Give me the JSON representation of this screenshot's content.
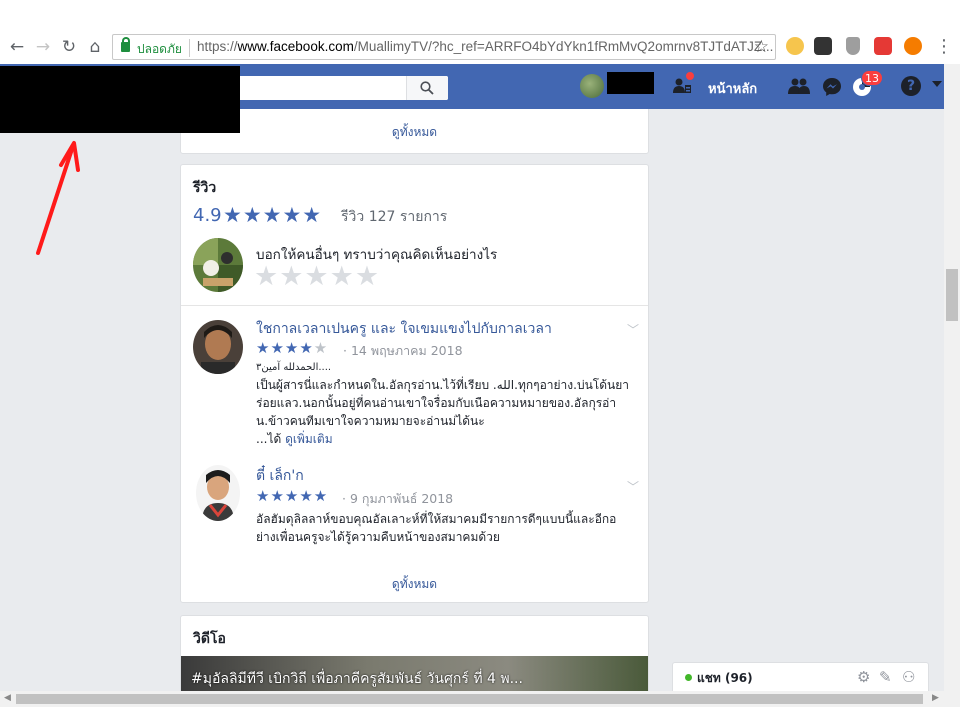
{
  "browser": {
    "secure_label": "ปลอดภัย",
    "url_prefix": "https://",
    "url_host": "www.facebook.com",
    "url_path": "/MuallimyTV/?hc_ref=ARRFO4bYdYkn1fRmMvQ2omrnv8TJTdATJZ...",
    "back_icon": "arrow-left-icon",
    "forward_icon": "arrow-right-icon",
    "reload_icon": "reload-icon",
    "home_icon": "home-icon",
    "bookmark_icon": "star-icon",
    "extension_icons": [
      "emoji-extension-icon",
      "ghostery-extension-icon",
      "shield-extension-icon",
      "red-extension-icon",
      "orange-extension-icon"
    ],
    "menu_icon": "vertical-dots-icon"
  },
  "fb_header": {
    "home_label": "หน้าหลัก",
    "notification_count": "13",
    "icons": [
      "search-icon",
      "find-friends-icon",
      "friend-requests-icon",
      "messenger-icon",
      "notifications-icon",
      "help-icon",
      "account-menu-caret-icon"
    ],
    "brand_color": "#4267b2"
  },
  "top_card": {
    "see_all": "ดูทั้งหมด"
  },
  "reviews": {
    "title": "รีวิว",
    "rating": "4.9",
    "stars": "★★★★★",
    "count_text": "รีวิว 127 รายการ",
    "prompt": "บอกให้คนอื่นๆ ทราบว่าคุณคิดเห็นอย่างไร",
    "empty_stars": "★★★★★",
    "items": [
      {
        "name": "ใชกาลเวลาเปนครู และ ใจเขมแขงไปกับกาลเวลา",
        "stars_on": "★★★★",
        "stars_off": "★",
        "date": "· 14 พฤษภาคม 2018",
        "lines": [
          "الحمدلله آمين٣....",
          "เป็นผู้สารนี่และกำหนดใน.อัลกุรอ่าน.ไว้ที่เรียบ .الله.ทุกๆอาย่าง.บ่นโด้นยา",
          "ร่อยแลว.นอกนั้นอยู่ที่คนอ่านเขาใจรื่อมกับเนือความหมายของ.อัลกุรอ่า",
          "น.ข้าวคนทีมเขาใจความหมายจะอ่านม่ได้นะ"
        ],
        "more_prefix": "...ได้ ",
        "more_link": "ดูเพิ่มเติม"
      },
      {
        "name": "ตี๋ เล็ก'ก",
        "stars_on": "★★★★★",
        "stars_off": "",
        "date": "· 9 กุมภาพันธ์ 2018",
        "lines": [
          "อัลฮัมดุลิลลาห์ขอบคุณอัลเลาะห์ที่ให้สมาคมมีรายการดีๆแบบนี้และอีกอ",
          "ย่างเพื่อนครูจะได้รู้ความคืบหน้าของสมาคมด้วย"
        ]
      }
    ],
    "see_all": "ดูทั้งหมด"
  },
  "videos": {
    "title": "วิดีโอ",
    "video_title": "#มุอัลลิมีทีวี เบิกวิถี เพื่อภาคีครูสัมพันธ์ วันศุกร์ ที่ 4 พ..."
  },
  "chat": {
    "label": "แชท (96)",
    "icons": [
      "gear-icon",
      "compose-icon",
      "group-chat-icon"
    ]
  }
}
